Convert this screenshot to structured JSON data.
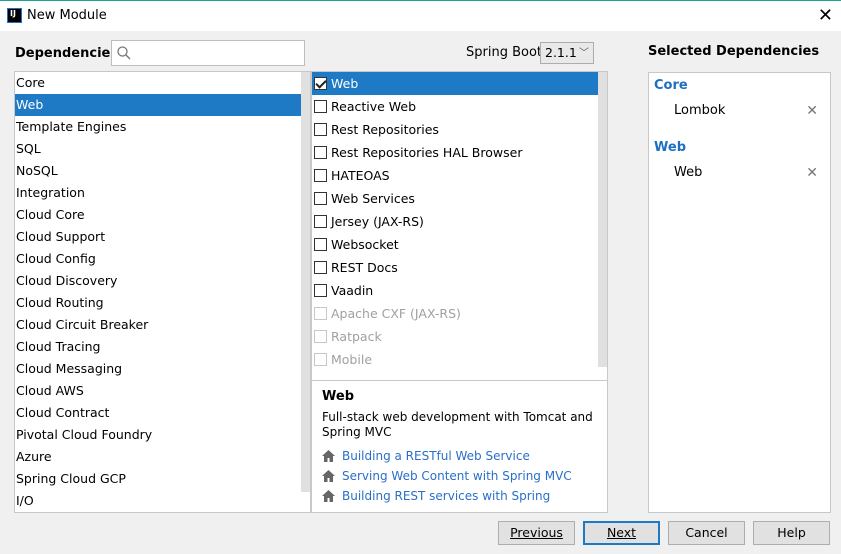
{
  "window": {
    "title": "New Module"
  },
  "dependencies_label": "Dependencies",
  "search": {
    "placeholder": "",
    "value": ""
  },
  "spring_boot": {
    "label": "Spring Boot",
    "version": "2.1.1"
  },
  "categories": [
    "Core",
    "Web",
    "Template Engines",
    "SQL",
    "NoSQL",
    "Integration",
    "Cloud Core",
    "Cloud Support",
    "Cloud Config",
    "Cloud Discovery",
    "Cloud Routing",
    "Cloud Circuit Breaker",
    "Cloud Tracing",
    "Cloud Messaging",
    "Cloud AWS",
    "Cloud Contract",
    "Pivotal Cloud Foundry",
    "Azure",
    "Spring Cloud GCP",
    "I/O"
  ],
  "selected_category": "Web",
  "deps": [
    {
      "label": "Web",
      "checked": true,
      "enabled": true,
      "selected": true
    },
    {
      "label": "Reactive Web",
      "checked": false,
      "enabled": true
    },
    {
      "label": "Rest Repositories",
      "checked": false,
      "enabled": true
    },
    {
      "label": "Rest Repositories HAL Browser",
      "checked": false,
      "enabled": true
    },
    {
      "label": "HATEOAS",
      "checked": false,
      "enabled": true
    },
    {
      "label": "Web Services",
      "checked": false,
      "enabled": true
    },
    {
      "label": "Jersey (JAX-RS)",
      "checked": false,
      "enabled": true
    },
    {
      "label": "Websocket",
      "checked": false,
      "enabled": true
    },
    {
      "label": "REST Docs",
      "checked": false,
      "enabled": true
    },
    {
      "label": "Vaadin",
      "checked": false,
      "enabled": true
    },
    {
      "label": "Apache CXF (JAX-RS)",
      "checked": false,
      "enabled": false
    },
    {
      "label": "Ratpack",
      "checked": false,
      "enabled": false
    },
    {
      "label": "Mobile",
      "checked": false,
      "enabled": false
    }
  ],
  "description": {
    "title": "Web",
    "text": "Full-stack web development with Tomcat and Spring MVC",
    "links": [
      "Building a RESTful Web Service",
      "Serving Web Content with Spring MVC",
      "Building REST services with Spring"
    ]
  },
  "selected": {
    "label": "Selected Dependencies",
    "groups": [
      {
        "name": "Core",
        "items": [
          "Lombok"
        ]
      },
      {
        "name": "Web",
        "items": [
          "Web"
        ]
      }
    ],
    "remove_glyph": "✕"
  },
  "buttons": {
    "previous": "Previous",
    "next": "Next",
    "cancel": "Cancel",
    "help": "Help"
  },
  "colors": {
    "selection": "#1e7ac5",
    "group": "#1e6ec2",
    "link": "#2a6fc9"
  }
}
